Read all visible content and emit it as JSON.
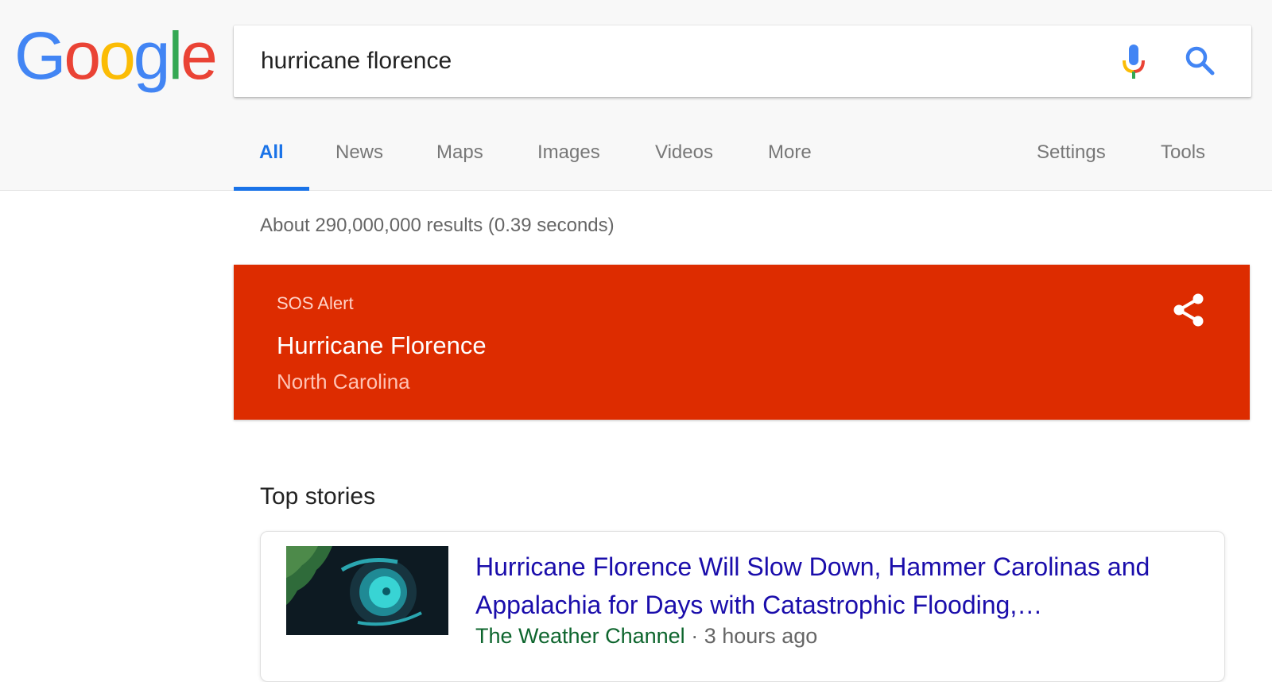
{
  "logo": {
    "letters": [
      "G",
      "o",
      "o",
      "g",
      "l",
      "e"
    ]
  },
  "search": {
    "query": "hurricane florence"
  },
  "tabs": [
    {
      "label": "All",
      "active": true
    },
    {
      "label": "News"
    },
    {
      "label": "Maps"
    },
    {
      "label": "Images"
    },
    {
      "label": "Videos"
    },
    {
      "label": "More"
    },
    {
      "label": "Settings"
    },
    {
      "label": "Tools"
    }
  ],
  "results_stats": "About 290,000,000 results (0.39 seconds)",
  "sos_alert": {
    "label": "SOS Alert",
    "title": "Hurricane Florence",
    "location": "North Carolina",
    "background_color": "#dd2c00"
  },
  "top_stories": {
    "heading": "Top stories",
    "items": [
      {
        "title": "Hurricane Florence Will Slow Down, Hammer Carolinas and Appalachia for Days with Catastrophic Flooding,…",
        "source": "The Weather Channel",
        "separator": "·",
        "time": "3 hours ago"
      }
    ]
  },
  "colors": {
    "google_blue": "#4285f4",
    "google_red": "#ea4335",
    "google_yellow": "#fbbc05",
    "google_green": "#34a853",
    "link": "#1a0dab",
    "active_tab": "#1a73e8"
  }
}
